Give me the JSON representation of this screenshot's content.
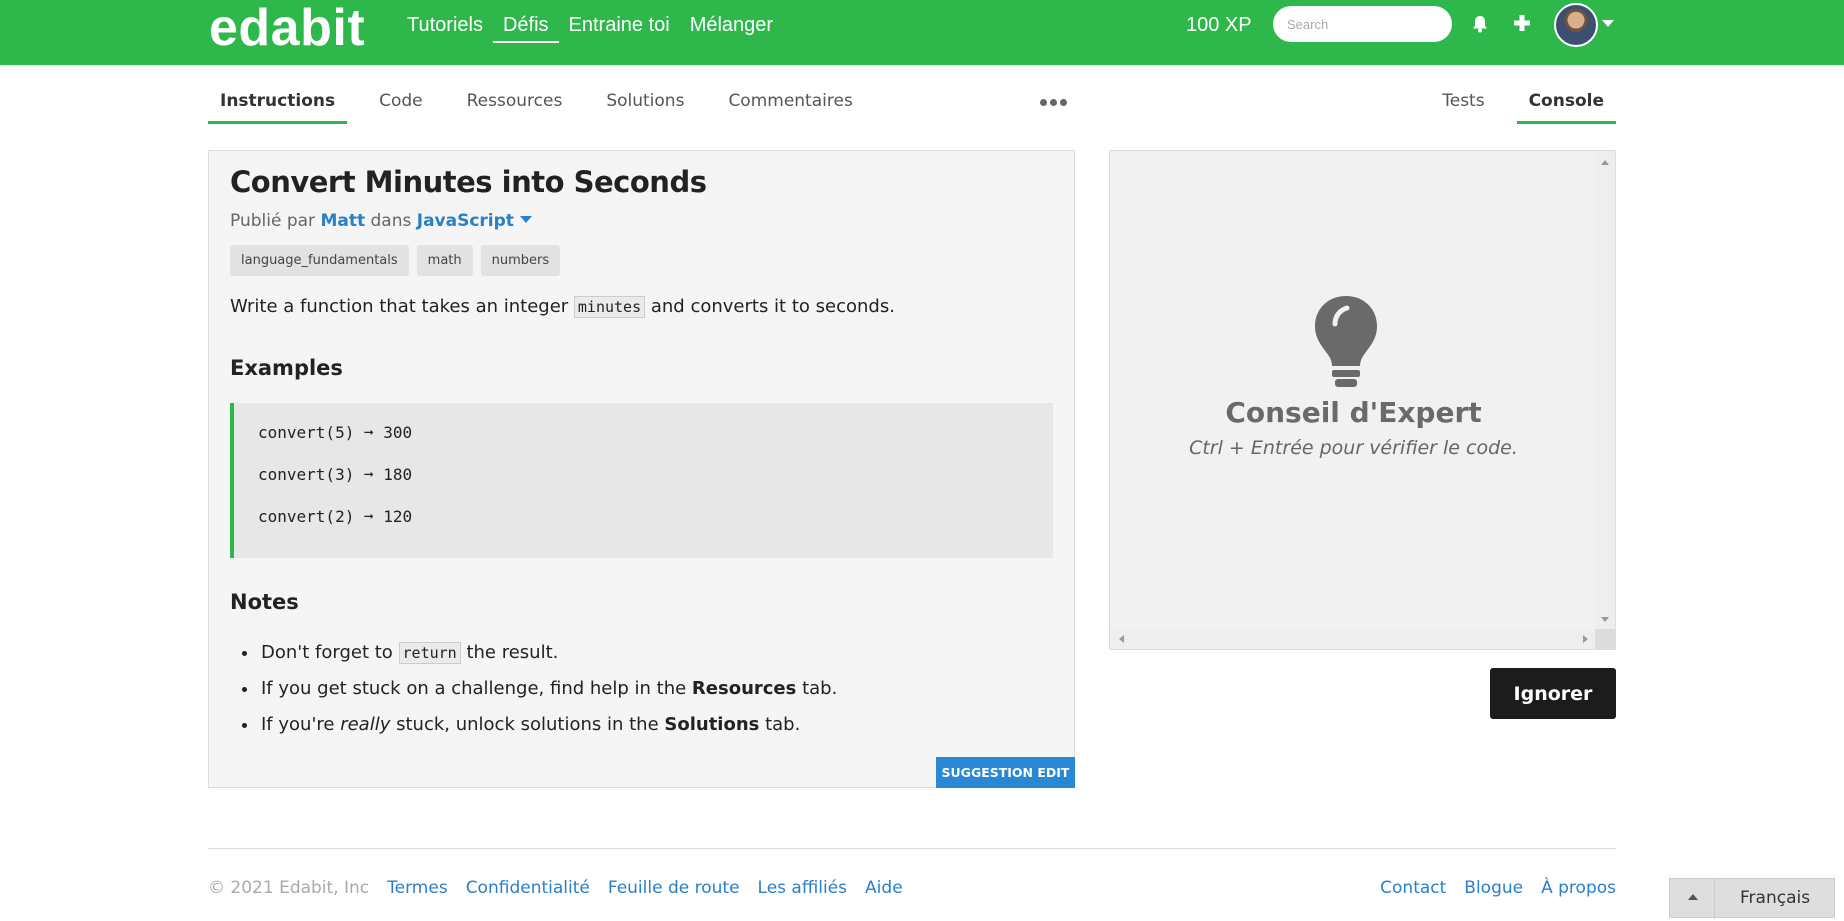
{
  "header": {
    "logo": "edabit",
    "nav": [
      "Tutoriels",
      "Défis",
      "Entraine toi",
      "Mélanger"
    ],
    "active_nav": "Défis",
    "xp": "100 XP",
    "search_placeholder": "Search",
    "brand_color": "#2eb84b",
    "icons": [
      "bell-icon",
      "plus-icon",
      "avatar",
      "chevron-down-icon"
    ]
  },
  "tabs": {
    "left": [
      "Instructions",
      "Code",
      "Ressources",
      "Solutions",
      "Commentaires"
    ],
    "right": [
      "Tests",
      "Console"
    ],
    "active_left": "Instructions",
    "active_right": "Console"
  },
  "challenge": {
    "title": "Convert Minutes into Seconds",
    "published_prefix": "Publié par",
    "author": "Matt",
    "in_word": "dans",
    "language": "JavaScript",
    "tags": [
      "language_fundamentals",
      "math",
      "numbers"
    ],
    "desc_before": "Write a function that takes an integer",
    "desc_code": "minutes",
    "desc_after": "and converts it to seconds.",
    "examples_heading": "Examples",
    "examples": [
      "convert(5) ➞ 300",
      "convert(3) ➞ 180",
      "convert(2) ➞ 120"
    ],
    "notes_heading": "Notes",
    "note1_before": "Don't forget to",
    "note1_code": "return",
    "note1_after": "the result.",
    "note2_before": "If you get stuck on a challenge, find help in the",
    "note2_bold": "Resources",
    "note2_after": "tab.",
    "note3_before": "If you're",
    "note3_italic": "really",
    "note3_middle": "stuck, unlock solutions in the",
    "note3_bold": "Solutions",
    "note3_after": "tab.",
    "suggest_label": "SUGGESTION EDIT"
  },
  "console": {
    "tip_title": "Conseil d'Expert",
    "tip_sub": "Ctrl + Entrée pour vérifier le code.",
    "ignore_label": "Ignorer"
  },
  "footer": {
    "copyright": "© 2021 Edabit, Inc",
    "left_links": [
      "Termes",
      "Confidentialité",
      "Feuille de route",
      "Les affiliés",
      "Aide"
    ],
    "right_links": [
      "Contact",
      "Blogue",
      "À propos"
    ],
    "language": "Français"
  }
}
